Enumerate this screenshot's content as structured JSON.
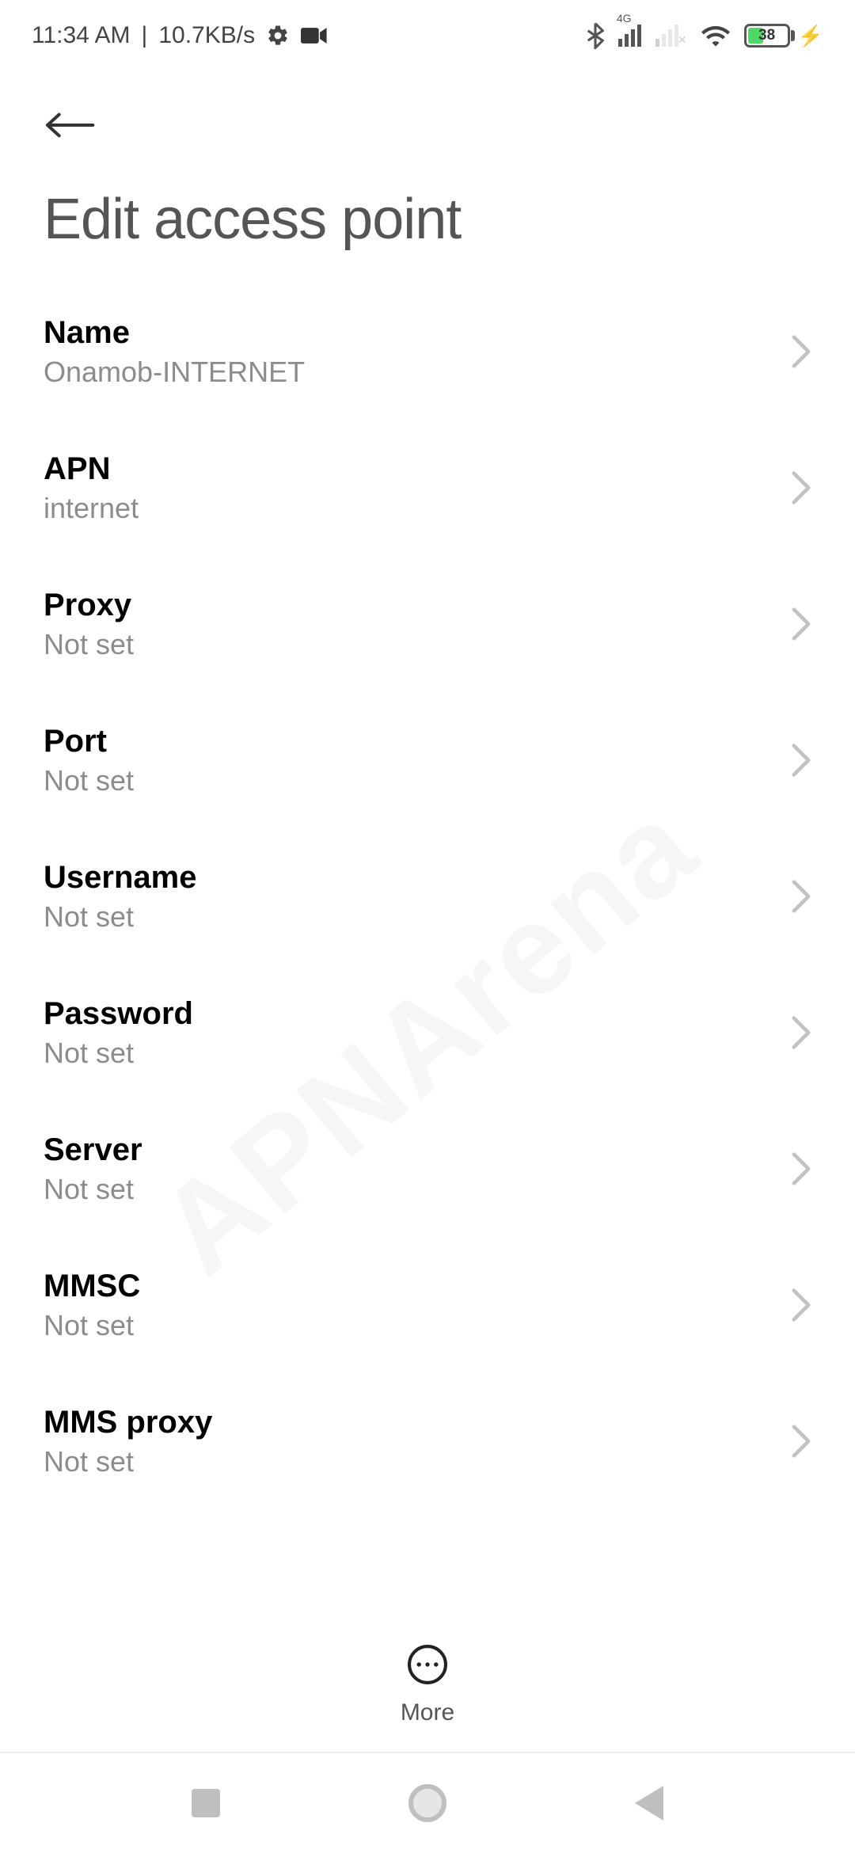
{
  "statusbar": {
    "time": "11:34 AM",
    "separator": "|",
    "net_rate": "10.7KB/s",
    "net_badge": "4G",
    "battery_percent": "38"
  },
  "page": {
    "title": "Edit access point"
  },
  "rows": [
    {
      "label": "Name",
      "value": "Onamob-INTERNET"
    },
    {
      "label": "APN",
      "value": "internet"
    },
    {
      "label": "Proxy",
      "value": "Not set"
    },
    {
      "label": "Port",
      "value": "Not set"
    },
    {
      "label": "Username",
      "value": "Not set"
    },
    {
      "label": "Password",
      "value": "Not set"
    },
    {
      "label": "Server",
      "value": "Not set"
    },
    {
      "label": "MMSC",
      "value": "Not set"
    },
    {
      "label": "MMS proxy",
      "value": "Not set"
    }
  ],
  "bottom": {
    "more": "More"
  },
  "watermark": {
    "text": "APNArena"
  }
}
